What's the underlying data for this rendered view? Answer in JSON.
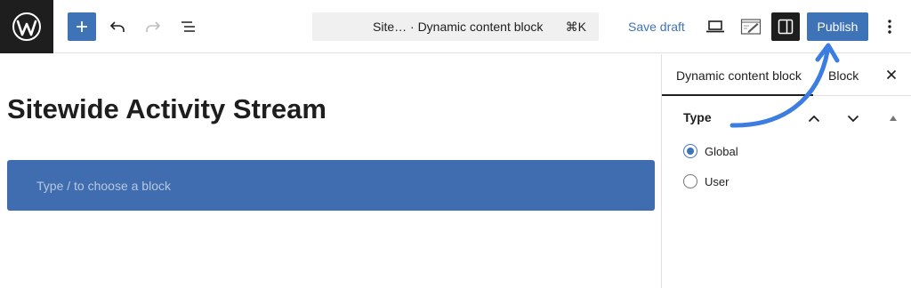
{
  "toolbar": {
    "command_bar": {
      "title": "Site…  · Dynamic content block",
      "shortcut": "⌘K"
    },
    "save_draft_label": "Save draft",
    "publish_label": "Publish",
    "icons": [
      "wordpress-logo-icon",
      "plus-icon",
      "undo-icon",
      "redo-icon",
      "list-view-icon",
      "desktop-preview-icon",
      "edit-icon",
      "sidebar-toggle-icon",
      "more-vertical-icon"
    ]
  },
  "editor": {
    "post_title": "Sitewide Activity Stream",
    "block_placeholder": "Type / to choose a block"
  },
  "sidebar": {
    "tabs": [
      {
        "label": "Dynamic content block",
        "active": true
      },
      {
        "label": "Block",
        "active": false
      }
    ],
    "panel": {
      "title": "Type",
      "options": [
        {
          "label": "Global",
          "checked": true
        },
        {
          "label": "User",
          "checked": false
        }
      ]
    }
  },
  "colors": {
    "accent": "#3f73b8",
    "block_background": "#3f6daf",
    "annotation_arrow": "#3b7de0",
    "dark": "#1e1e1e"
  }
}
